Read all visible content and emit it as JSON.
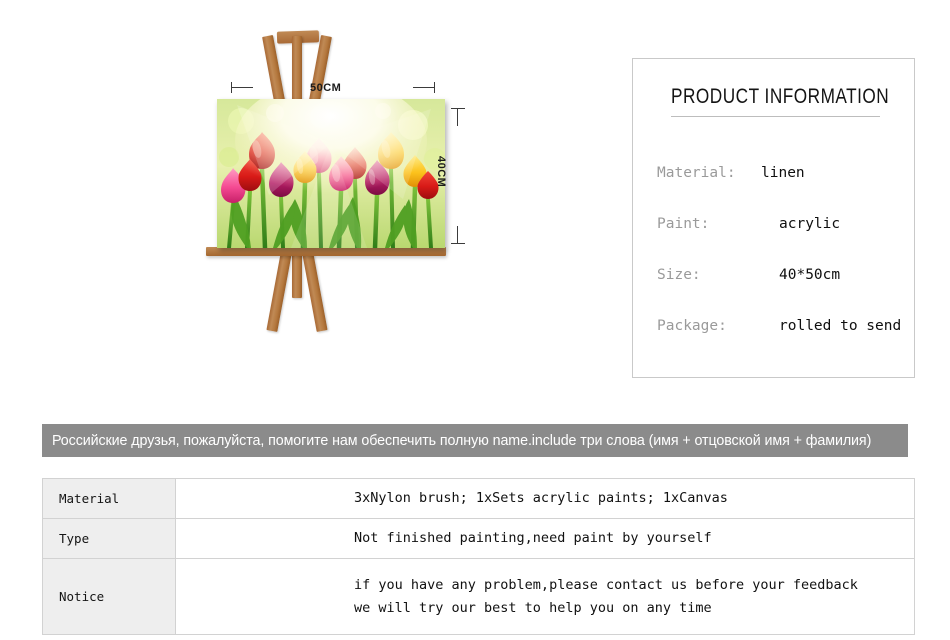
{
  "easel": {
    "painting_alt": "tulip-field-painting",
    "dimensions": {
      "width_label": "50CM",
      "height_label": "40CM"
    }
  },
  "product_panel": {
    "title": "PRODUCT INFORMATION",
    "specs": [
      {
        "label": "Material:",
        "value": "linen"
      },
      {
        "label": "Paint:",
        "value": "acrylic"
      },
      {
        "label": "Size:",
        "value": "40*50cm"
      },
      {
        "label": "Package:",
        "value": "rolled to send"
      }
    ]
  },
  "notice_banner": {
    "text": "Российские друзья, пожалуйста, помогите нам обеспечить полную name.include три слова (имя + отцовской имя + фамилия)",
    "background_color": "#8b8b8b",
    "text_color": "#ffffff"
  },
  "spec_table": {
    "rows": [
      {
        "label": "Material",
        "lines": [
          "3xNylon brush; 1xSets acrylic paints;  1xCanvas"
        ]
      },
      {
        "label": "Type",
        "lines": [
          "Not finished painting,need paint by yourself"
        ]
      },
      {
        "label": "Notice",
        "lines": [
          "if you have any problem,please contact us before your feedback",
          "we will try our best to help you on any time"
        ]
      }
    ]
  },
  "colors": {
    "easel_wood": "#b5793f",
    "panel_border": "#c9c9c9",
    "table_label_bg": "#eeeeee",
    "spec_label_gray": "#9a9a9a"
  }
}
